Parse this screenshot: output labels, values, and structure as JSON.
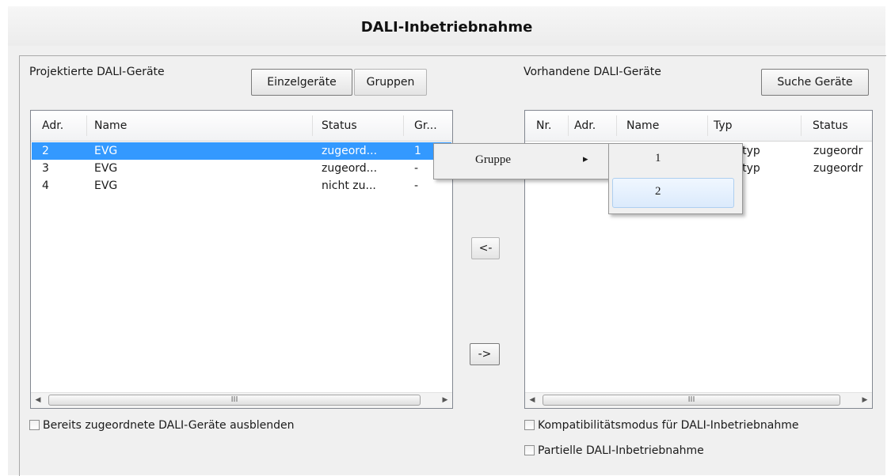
{
  "window": {
    "title": "DALI-Inbetriebnahme"
  },
  "left_panel": {
    "label": "Projektierte DALI-Geräte",
    "tab_single": "Einzelgeräte",
    "tab_groups": "Gruppen",
    "columns": [
      "Adr.",
      "Name",
      "Status",
      "Gr..."
    ],
    "rows": [
      {
        "adr": "2",
        "name": "EVG",
        "status": "zugeord...",
        "gr": "1",
        "selected": true
      },
      {
        "adr": "3",
        "name": "EVG",
        "status": "zugeord...",
        "gr": "-",
        "selected": false
      },
      {
        "adr": "4",
        "name": "EVG",
        "status": "nicht zu...",
        "gr": "-",
        "selected": false
      }
    ],
    "hide_checkbox_label": "Bereits zugeordnete DALI-Geräte ausblenden"
  },
  "middle": {
    "assign_left": "<-",
    "assign_right": "->"
  },
  "right_panel": {
    "label": "Vorhandene DALI-Geräte",
    "search_button": "Suche Geräte",
    "columns": [
      "Nr.",
      "Adr.",
      "Name",
      "Typ",
      "Status"
    ],
    "rows": [
      {
        "typ": "ıltityp",
        "status": "zugeordr"
      },
      {
        "typ": "ıltityp",
        "status": "zugeordr"
      }
    ],
    "compat_checkbox_label": "Kompatibilitätsmodus für DALI-Inbetriebnahme",
    "partial_checkbox_label": "Partielle DALI-Inbetriebnahme"
  },
  "scrollbar_grip": "III",
  "context_menu": {
    "item": "Gruppe",
    "arrow": "▸",
    "submenu": [
      "1",
      "2"
    ]
  }
}
